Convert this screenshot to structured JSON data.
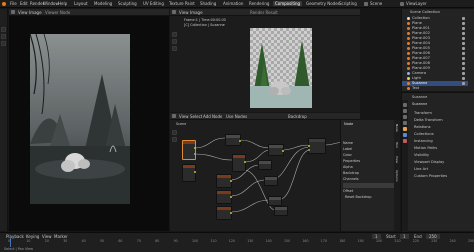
{
  "app": {
    "logo_icon": "blender-logo-icon"
  },
  "menubar": {
    "items": [
      "File",
      "Edit",
      "Render",
      "Window",
      "Help"
    ],
    "workspaces": [
      "Layout",
      "Modeling",
      "Sculpting",
      "UV Editing",
      "Texture Paint",
      "Shading",
      "Animation",
      "Rendering",
      "Compositing",
      "Geometry Nodes",
      "Scripting"
    ],
    "active_workspace_index": 9,
    "scene": "Scene",
    "view_layer": "ViewLayer"
  },
  "viewer": {
    "header_items": [
      "View",
      "Image"
    ],
    "image_name": "Viewer Node"
  },
  "preview": {
    "header_items": [
      "View",
      "Image"
    ],
    "render_info": "Render Result",
    "info_line1": "Frame:1 | Time:00:00.00",
    "info_line2": "[C] Collection | Suzanne"
  },
  "node_editor": {
    "header_items": [
      "View",
      "Select",
      "Add",
      "Node"
    ],
    "use_nodes_label": "Use Nodes",
    "breadcrumb": "Scene",
    "backdrop_label": "Backdrop"
  },
  "npanel": {
    "tabs": [
      "Node",
      "Tool",
      "View",
      "Options"
    ],
    "title": "Node",
    "rows": [
      "Name",
      "Label",
      "Color",
      "Properties",
      "Alpha",
      "Backdrop",
      "Channels",
      "Zoom",
      "Offset",
      "Reset Backdrop"
    ]
  },
  "outliner": {
    "title": "Scene Collection",
    "rows": [
      "Collection",
      "Plane",
      "Plane.001",
      "Plane.002",
      "Plane.003",
      "Plane.004",
      "Plane.005",
      "Plane.006",
      "Plane.007",
      "Plane.008",
      "Plane.009",
      "Camera",
      "Light",
      "Suzanne",
      "Text"
    ]
  },
  "properties": {
    "object_name": "Suzanne",
    "section_title": "Suzanne",
    "rows": [
      "Transform",
      "Delta Transform",
      "Relations",
      "Collections",
      "Instancing",
      "Motion Paths",
      "Visibility",
      "Viewport Display",
      "Line Art",
      "Custom Properties"
    ]
  },
  "timeline": {
    "header_items": [
      "Playback",
      "Keying",
      "View",
      "Marker"
    ],
    "frame_current": "1",
    "start_label": "Start",
    "start": "1",
    "end_label": "End",
    "end": "250",
    "ticks": [
      "0",
      "10",
      "20",
      "30",
      "40",
      "50",
      "60",
      "70",
      "80",
      "90",
      "100",
      "110",
      "120",
      "130",
      "140",
      "150",
      "160",
      "170",
      "180",
      "190",
      "200",
      "210",
      "220",
      "230",
      "240",
      "250"
    ],
    "status": "Select | Pan View"
  }
}
